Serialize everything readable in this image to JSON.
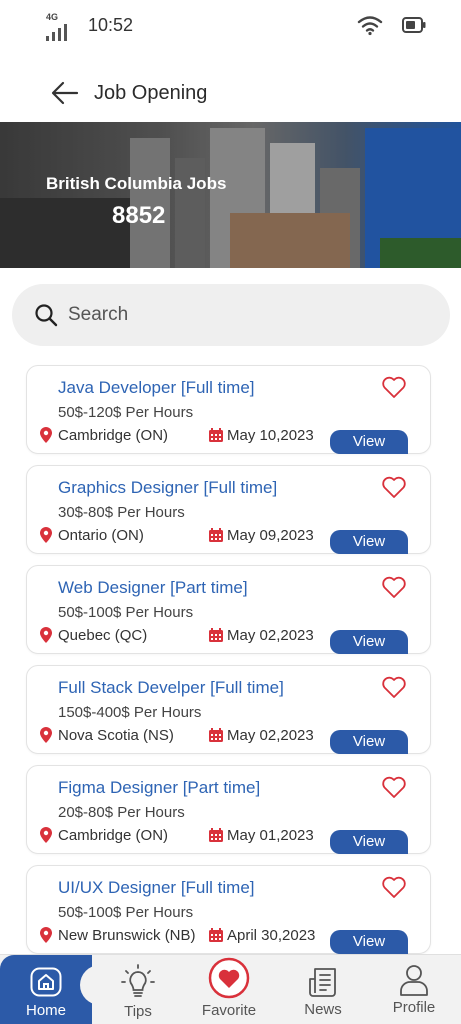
{
  "status_bar": {
    "network": "4G",
    "time": "10:52"
  },
  "header": {
    "title": "Job Opening"
  },
  "banner": {
    "title": "British Columbia Jobs",
    "count": "8852"
  },
  "search": {
    "placeholder": "Search"
  },
  "jobs": [
    {
      "title": "Java Developer [Full time]",
      "pay": "50$-120$ Per Hours",
      "location": "Cambridge (ON)",
      "date": "May 10,2023",
      "view_label": "View"
    },
    {
      "title": "Graphics Designer [Full time]",
      "pay": "30$-80$ Per Hours",
      "location": "Ontario (ON)",
      "date": "May 09,2023",
      "view_label": "View"
    },
    {
      "title": "Web Designer [Part time]",
      "pay": "50$-100$ Per Hours",
      "location": "Quebec (QC)",
      "date": "May 02,2023",
      "view_label": "View"
    },
    {
      "title": "Full Stack Develper [Full time]",
      "pay": "150$-400$ Per Hours",
      "location": "Nova Scotia (NS)",
      "date": "May 02,2023",
      "view_label": "View"
    },
    {
      "title": "Figma Designer [Part time]",
      "pay": "20$-80$ Per Hours",
      "location": "Cambridge (ON)",
      "date": "May 01,2023",
      "view_label": "View"
    },
    {
      "title": "UI/UX Designer [Full time]",
      "pay": "50$-100$ Per Hours",
      "location": "New Brunswick (NB)",
      "date": "April 30,2023",
      "view_label": "View"
    }
  ],
  "bottom_nav": [
    {
      "label": "Home",
      "icon": "home-icon",
      "active": true
    },
    {
      "label": "Tips",
      "icon": "lightbulb-icon",
      "active": false
    },
    {
      "label": "Favorite",
      "icon": "heart-icon",
      "active": false
    },
    {
      "label": "News",
      "icon": "news-icon",
      "active": false
    },
    {
      "label": "Profile",
      "icon": "profile-icon",
      "active": false
    }
  ],
  "colors": {
    "primary": "#2c5aa8",
    "title_blue": "#2e64b4",
    "accent_red": "#d9313b"
  }
}
